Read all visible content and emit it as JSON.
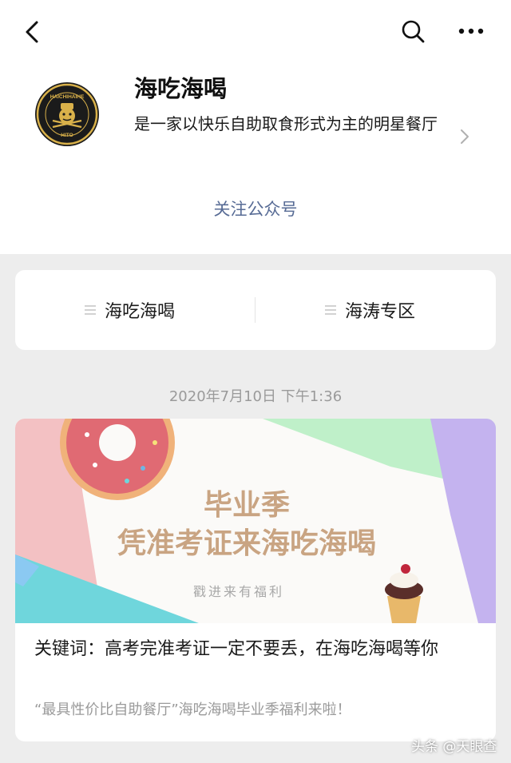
{
  "header": {
    "back_icon": "back-chevron-icon",
    "search_icon": "search-icon",
    "more_icon": "more-dots-icon"
  },
  "account": {
    "name": "海吃海喝",
    "description": "是一家以快乐自助取食形式为主的明星餐厅",
    "logo_text_top": "HAICHIHAIHE",
    "logo_text_bottom": "HITO",
    "follow_label": "关注公众号"
  },
  "menu": {
    "items": [
      {
        "label": "海吃海喝",
        "icon": "menu-lines-icon"
      },
      {
        "label": "海涛专区",
        "icon": "menu-lines-icon"
      }
    ]
  },
  "feed": {
    "date": "2020年7月10日 下午1:36",
    "article": {
      "banner_title_line1": "毕业季",
      "banner_title_line2": "凭准考证来海吃海喝",
      "banner_subtitle": "戳进来有福利",
      "title": "关键词：高考完准考证一定不要丢，在海吃海喝等你",
      "summary": "“最具性价比自助餐厅”海吃海喝毕业季福利来啦！"
    }
  },
  "watermark": "头条 @天眼查",
  "colors": {
    "link": "#576b95",
    "muted": "#9a9a9a",
    "banner_title": "#c9a482",
    "logo_gold": "#d9b14a"
  }
}
